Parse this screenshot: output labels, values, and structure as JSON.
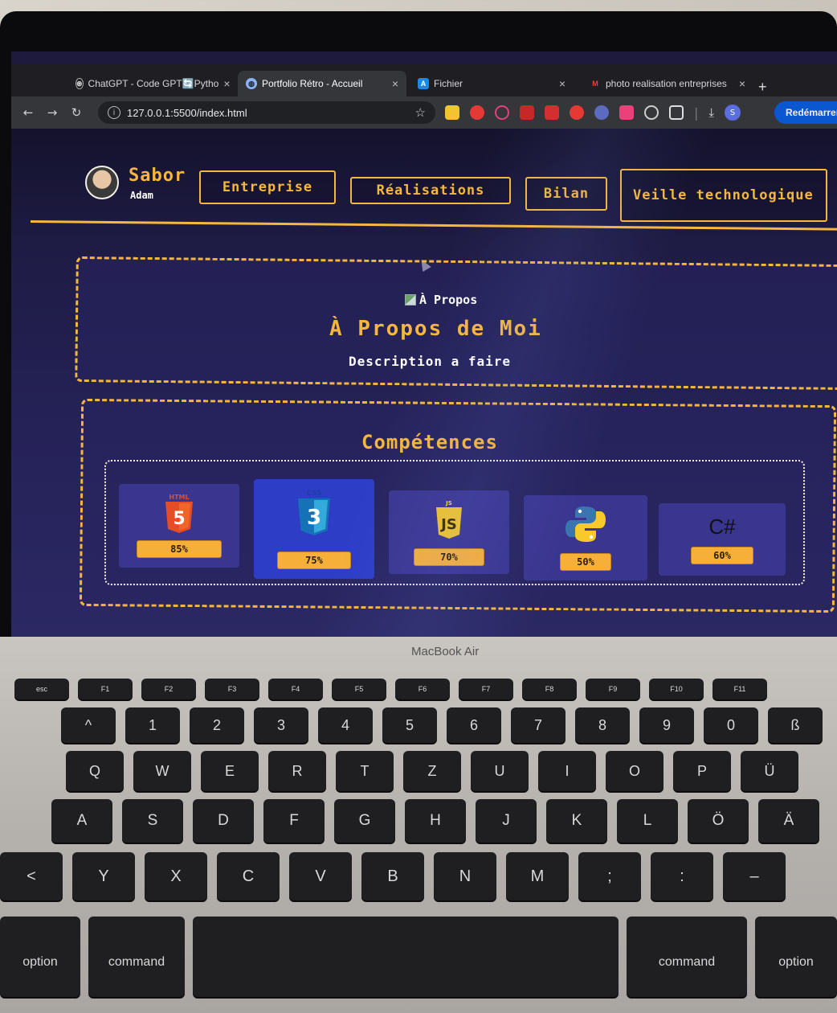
{
  "browser": {
    "tabs": [
      {
        "title": "ChatGPT - Code GPT🔄Pytho",
        "active": false,
        "icon": "chatgpt-icon"
      },
      {
        "title": "Portfolio Rétro - Accueil",
        "active": true,
        "icon": "globe-icon"
      },
      {
        "title": "Fichier",
        "active": false,
        "icon": "drive-icon"
      },
      {
        "title": "photo realisation entreprises",
        "active": false,
        "icon": "gmail-icon"
      }
    ],
    "new_tab": "+",
    "url": "127.0.0.1:5500/index.html",
    "profile_initial": "S",
    "restart_label": "Redémarrer"
  },
  "site": {
    "brand_name": "Sabor",
    "brand_sub": "Adam",
    "nav": [
      "Entreprise",
      "Réalisations",
      "Bilan",
      "Veille technologique"
    ],
    "about": {
      "img_alt": "À Propos",
      "title": "À Propos de Moi",
      "description": "Description a faire"
    },
    "skills": {
      "title": "Compétences",
      "items": [
        {
          "name": "HTML",
          "logo": "html5-icon",
          "percent": "85%",
          "value": 85
        },
        {
          "name": "CSS",
          "logo": "css3-icon",
          "percent": "75%",
          "value": 75
        },
        {
          "name": "JS",
          "logo": "javascript-icon",
          "percent": "70%",
          "value": 70
        },
        {
          "name": "Python",
          "logo": "python-icon",
          "percent": "50%",
          "value": 50
        },
        {
          "name": "C#",
          "logo": "csharp-icon",
          "percent": "60%",
          "value": 60
        }
      ]
    }
  },
  "laptop": {
    "model_label": "MacBook Air",
    "keys": {
      "row_fn": [
        "esc",
        "F1",
        "F2",
        "F3",
        "F4",
        "F5",
        "F6",
        "F7",
        "F8",
        "F9",
        "F10",
        "F11"
      ],
      "row_num": [
        "^",
        "1",
        "2",
        "3",
        "4",
        "5",
        "6",
        "7",
        "8",
        "9",
        "0",
        "ß"
      ],
      "row_q": [
        "Q",
        "W",
        "E",
        "R",
        "T",
        "Z",
        "U",
        "I",
        "O",
        "P",
        "Ü"
      ],
      "row_a": [
        "A",
        "S",
        "D",
        "F",
        "G",
        "H",
        "J",
        "K",
        "L",
        "Ö",
        "Ä"
      ],
      "row_y": [
        "<",
        "Y",
        "X",
        "C",
        "V",
        "B",
        "N",
        "M",
        ";",
        ":",
        "–"
      ],
      "row_mod": [
        "option",
        "command",
        "command",
        "option"
      ]
    }
  },
  "colors": {
    "accent": "#f6b73c",
    "page_bg": "#1e1b44",
    "card_bg": "#3a3690"
  }
}
